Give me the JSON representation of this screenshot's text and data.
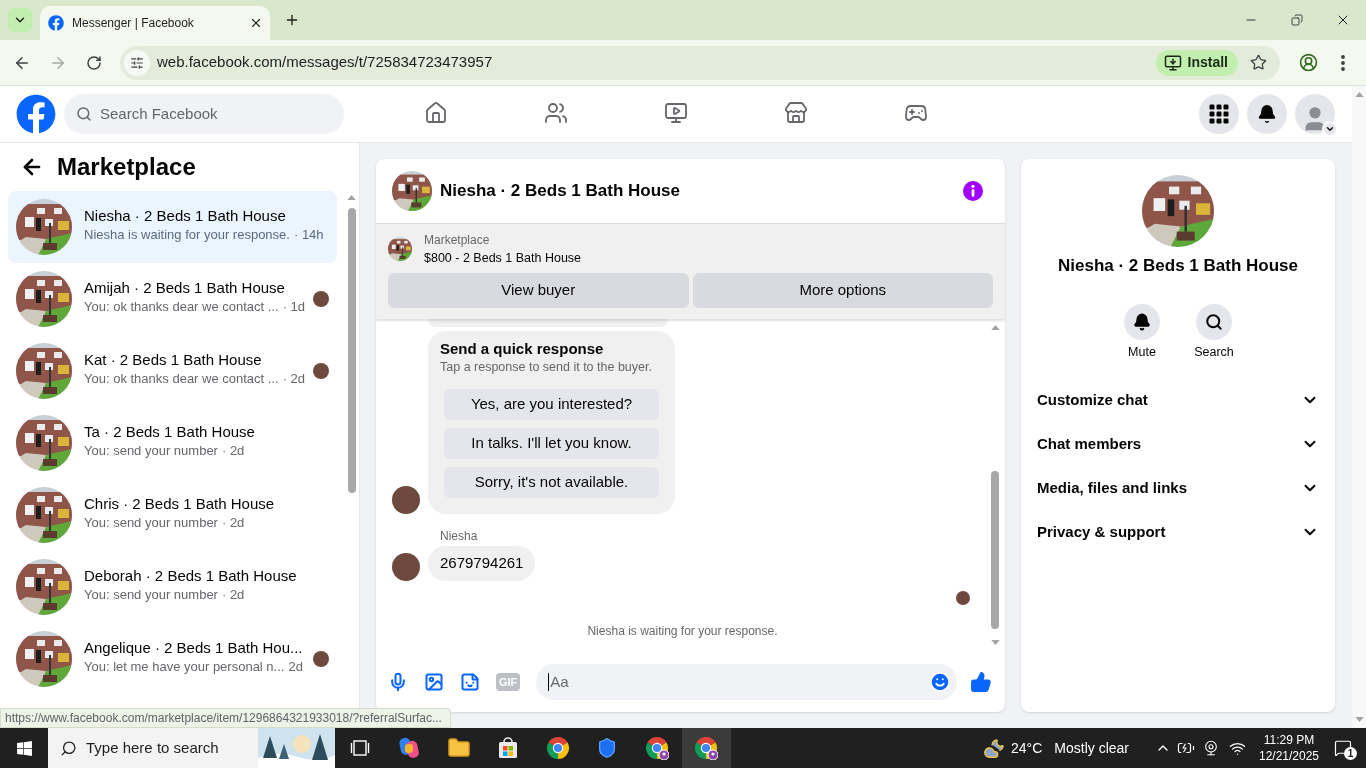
{
  "browser": {
    "tabs": [
      {
        "title": "Messenger | Facebook",
        "selected": true
      }
    ],
    "address": "web.facebook.com/messages/t/725834723473957",
    "install_label": "Install"
  },
  "topbar": {
    "search_placeholder": "Search Facebook",
    "nav": [
      {
        "kind": "home",
        "selected": false
      },
      {
        "kind": "friends",
        "selected": false
      },
      {
        "kind": "video",
        "selected": false
      },
      {
        "kind": "marketplace",
        "selected": false
      },
      {
        "kind": "gaming",
        "selected": false
      }
    ]
  },
  "sidebar": {
    "title": "Marketplace",
    "conversations": [
      {
        "name": "Niesha · 2 Beds 1 Bath House",
        "preview": "Niesha is waiting for your response.",
        "time": "· 14h",
        "selected": true,
        "seen": false
      },
      {
        "name": "Amijah · 2 Beds 1 Bath House",
        "preview": "You: ok thanks dear we contact ...",
        "time": "· 1d",
        "selected": false,
        "seen": true
      },
      {
        "name": "Kat · 2 Beds 1 Bath House",
        "preview": "You: ok thanks dear we contact ...",
        "time": "· 2d",
        "selected": false,
        "seen": true
      },
      {
        "name": "Ta · 2 Beds 1 Bath House",
        "preview": "You: send your number",
        "time": "· 2d",
        "selected": false,
        "seen": false
      },
      {
        "name": "Chris · 2 Beds 1 Bath House",
        "preview": "You: send your number",
        "time": "· 2d",
        "selected": false,
        "seen": false
      },
      {
        "name": "Deborah · 2 Beds 1 Bath House",
        "preview": "You: send your number",
        "time": "· 2d",
        "selected": false,
        "seen": false
      },
      {
        "name": "Angelique · 2 Beds 1 Bath Hou...",
        "preview": "You: let me have your personal n...",
        "time": "2d",
        "selected": false,
        "seen": true
      }
    ]
  },
  "chat": {
    "title": "Niesha · 2 Beds 1 Bath House",
    "listing": {
      "source": "Marketplace",
      "title": "$800 - 2 Beds 1 Bath House"
    },
    "actions": [
      "View buyer",
      "More options"
    ],
    "quick_response": {
      "title": "Send a quick response",
      "subtitle": "Tap a response to send it to the buyer.",
      "options": [
        "Yes, are you interested?",
        "In talks. I'll let you know.",
        "Sorry, it's not available."
      ]
    },
    "messages": [
      {
        "sender": "Niesha",
        "text": "2679794261"
      }
    ],
    "seen": true,
    "status": "Niesha is waiting for your response.",
    "composer": {
      "placeholder": "Aa",
      "gif_label": "GIF"
    }
  },
  "details": {
    "name": "Niesha · 2 Beds 1 Bath House",
    "actions": [
      {
        "kind": "mute",
        "label": "Mute"
      },
      {
        "kind": "search",
        "label": "Search"
      }
    ],
    "sections": [
      {
        "label": "Customize chat",
        "expanded": false
      },
      {
        "label": "Chat members",
        "expanded": false
      },
      {
        "label": "Media, files and links",
        "expanded": false
      },
      {
        "label": "Privacy & support",
        "expanded": false
      }
    ]
  },
  "status_url": "https://www.facebook.com/marketplace/item/1296864321933018/?referralSurfac...",
  "taskbar": {
    "search_placeholder": "Type here to search",
    "apps": [
      {
        "kind": "task_view",
        "active": false
      },
      {
        "kind": "copilot",
        "active": false
      },
      {
        "kind": "explorer",
        "active": false
      },
      {
        "kind": "store",
        "active": false
      },
      {
        "kind": "browser",
        "active": false
      },
      {
        "kind": "shield",
        "active": false
      },
      {
        "kind": "browser_profile",
        "active": false
      },
      {
        "kind": "browser_profile",
        "active": true
      }
    ],
    "weather": {
      "temperature": "24°C",
      "condition": "Mostly clear"
    },
    "time": "11:29 PM",
    "date": "12/21/2025",
    "notification_count": "1"
  }
}
